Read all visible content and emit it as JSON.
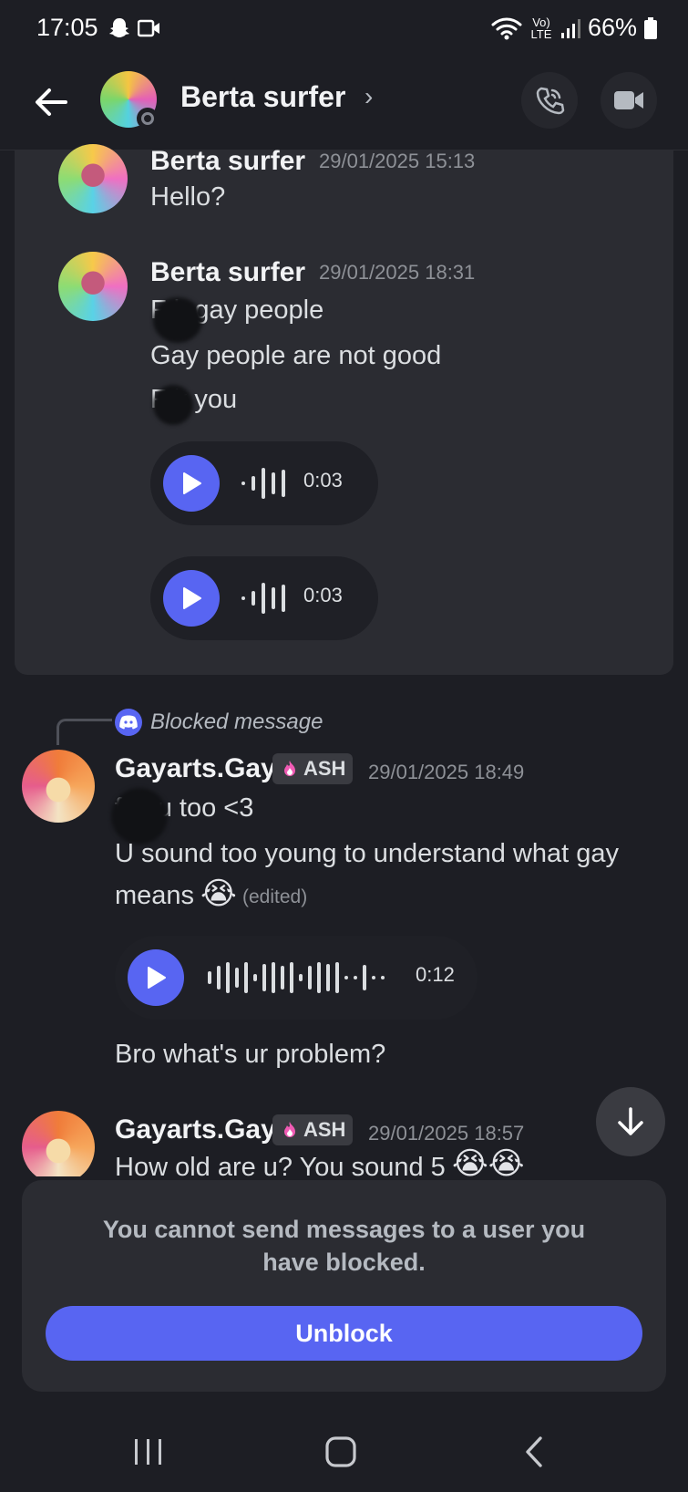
{
  "status_bar": {
    "time": "17:05",
    "network": "Vo) LTE",
    "battery": "66%"
  },
  "header": {
    "title": "Berta surfer",
    "chevron": "›"
  },
  "messages_blocked_group": [
    {
      "author": "Berta surfer",
      "timestamp": "29/01/2025 15:13",
      "lines": [
        "Hello?"
      ]
    },
    {
      "author": "Berta surfer",
      "timestamp": "29/01/2025 18:31",
      "lines": [
        "F  k gay people",
        "Gay people are not good",
        "F  k you"
      ],
      "voice": [
        {
          "duration": "0:03"
        },
        {
          "duration": "0:03"
        }
      ]
    }
  ],
  "reply": {
    "label": "Blocked message"
  },
  "messages": [
    {
      "author": "Gayarts.Gay",
      "badge": "ASH",
      "timestamp": "29/01/2025 18:49",
      "lines": [
        "f    you too <3",
        "U sound too young to understand what gay",
        "means"
      ],
      "emoji": "😭",
      "edited": "(edited)",
      "voice": {
        "duration": "0:12"
      },
      "after": "Bro what's ur problem?"
    },
    {
      "author": "Gayarts.Gay",
      "badge": "ASH",
      "timestamp": "29/01/2025 18:57",
      "lines": [
        "How old are u? You sound 5"
      ],
      "emoji": "😭😭"
    }
  ],
  "blocked_notice": {
    "text": "You cannot send messages to a user you have blocked.",
    "button": "Unblock"
  },
  "nav_icons": [
    "recent-apps-icon",
    "home-icon",
    "back-icon"
  ]
}
